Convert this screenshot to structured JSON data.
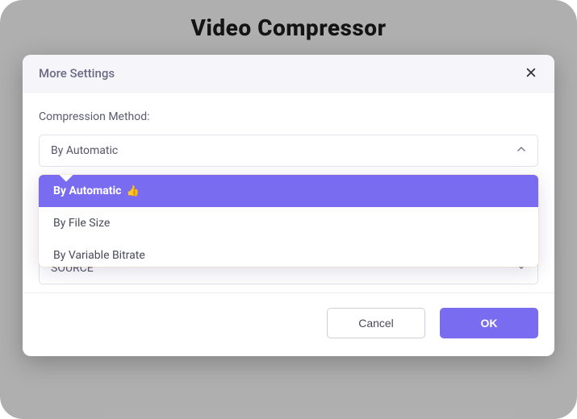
{
  "app": {
    "title": "Video Compressor"
  },
  "modal": {
    "title": "More Settings",
    "close_icon": "close-icon",
    "fields": {
      "compression_method": {
        "label": "Compression Method:",
        "selected": "By Automatic",
        "options": {
          "0": {
            "label": "By Automatic",
            "recommended": true
          },
          "1": {
            "label": "By File Size"
          },
          "2": {
            "label": "By Variable Bitrate"
          }
        }
      },
      "source_select": {
        "selected": "SOURCE"
      }
    },
    "buttons": {
      "cancel": "Cancel",
      "ok": "OK"
    }
  }
}
